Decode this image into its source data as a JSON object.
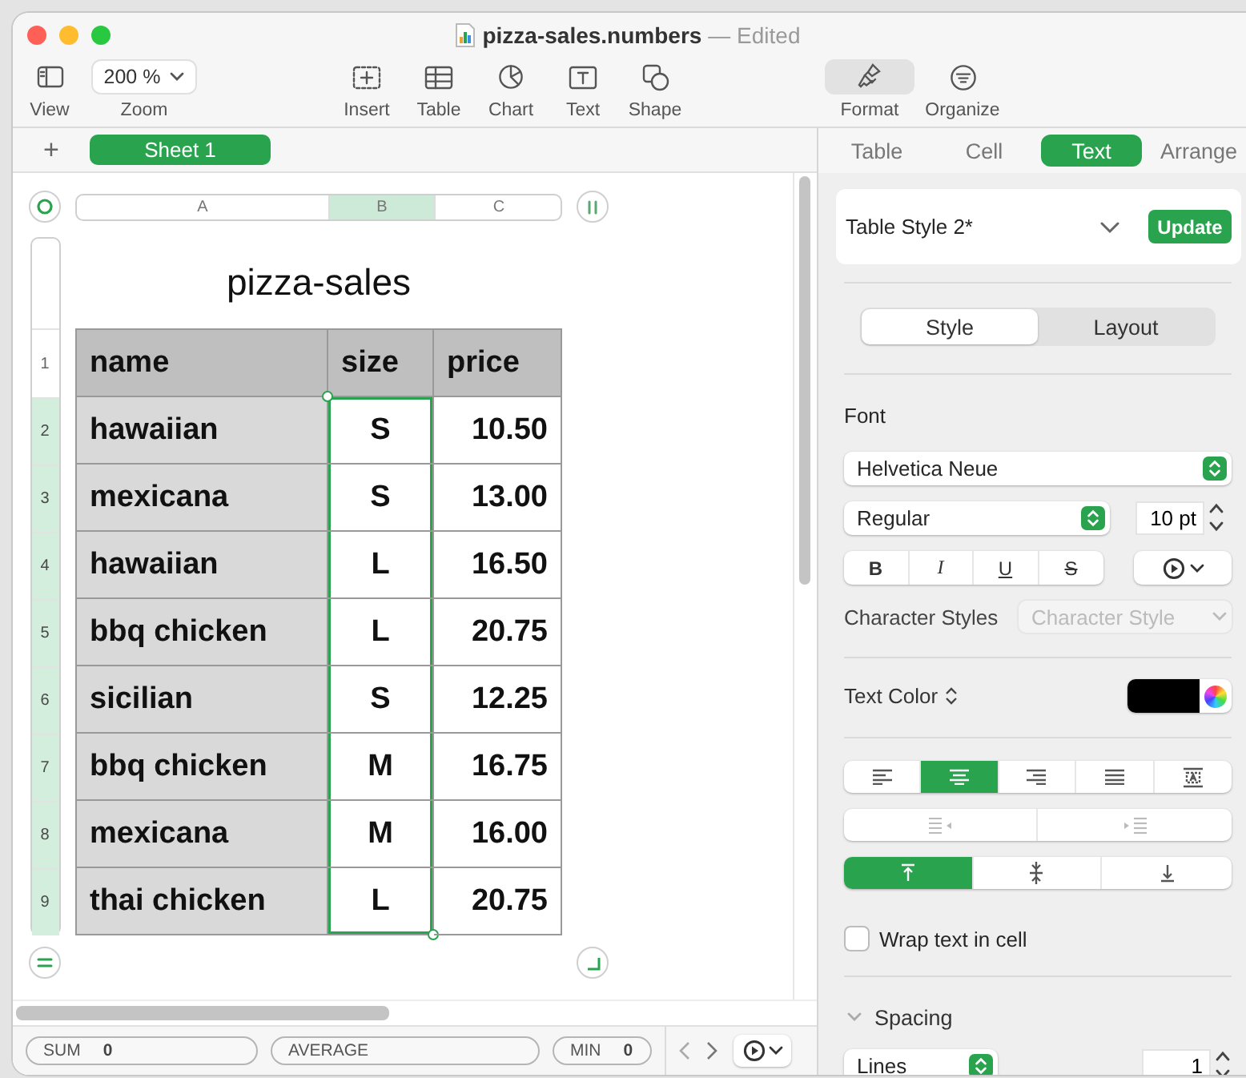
{
  "window": {
    "title": "pizza-sales.numbers",
    "status": "— Edited"
  },
  "toolbar": {
    "left": [
      {
        "kind": "view",
        "label": "View"
      },
      {
        "kind": "zoom",
        "label": "Zoom",
        "value": "200 %"
      }
    ],
    "insert": [
      {
        "kind": "insert",
        "label": "Insert"
      },
      {
        "kind": "table",
        "label": "Table"
      },
      {
        "kind": "chart",
        "label": "Chart"
      },
      {
        "kind": "text",
        "label": "Text"
      },
      {
        "kind": "shape",
        "label": "Shape"
      }
    ],
    "panels": [
      {
        "kind": "format",
        "label": "Format",
        "selected": true
      },
      {
        "kind": "organize",
        "label": "Organize",
        "selected": false
      }
    ]
  },
  "sheets": {
    "add": "+",
    "tabs": [
      {
        "label": "Sheet 1",
        "selected": true
      }
    ]
  },
  "table": {
    "title": "pizza-sales",
    "columns": [
      {
        "label": "A",
        "kind": "header",
        "selected": false
      },
      {
        "label": "B",
        "kind": "body",
        "selected": true
      },
      {
        "label": "C",
        "kind": "body",
        "selected": false
      }
    ],
    "rows": [
      {
        "number": "1",
        "kind": "header",
        "selected": false,
        "cells": [
          "name",
          "size",
          "price"
        ]
      },
      {
        "number": "2",
        "kind": "body",
        "selected": true,
        "cells": [
          "hawaiian",
          "S",
          "10.50"
        ]
      },
      {
        "number": "3",
        "kind": "body",
        "selected": true,
        "cells": [
          "mexicana",
          "S",
          "13.00"
        ]
      },
      {
        "number": "4",
        "kind": "body",
        "selected": true,
        "cells": [
          "hawaiian",
          "L",
          "16.50"
        ]
      },
      {
        "number": "5",
        "kind": "body",
        "selected": true,
        "cells": [
          "bbq chicken",
          "L",
          "20.75"
        ]
      },
      {
        "number": "6",
        "kind": "body",
        "selected": true,
        "cells": [
          "sicilian",
          "S",
          "12.25"
        ]
      },
      {
        "number": "7",
        "kind": "body",
        "selected": true,
        "cells": [
          "bbq chicken",
          "M",
          "16.75"
        ]
      },
      {
        "number": "8",
        "kind": "body",
        "selected": true,
        "cells": [
          "mexicana",
          "M",
          "16.00"
        ]
      },
      {
        "number": "9",
        "kind": "body",
        "selected": true,
        "cells": [
          "thai chicken",
          "L",
          "20.75"
        ]
      }
    ]
  },
  "status_bar": {
    "stats": [
      {
        "label": "SUM",
        "value": "0"
      },
      {
        "label": "AVERAGE"
      },
      {
        "label": "MIN",
        "value": "0"
      }
    ]
  },
  "inspector": {
    "tabs": [
      {
        "label": "Table",
        "selected": false
      },
      {
        "label": "Cell",
        "selected": false
      },
      {
        "label": "Text",
        "selected": true
      },
      {
        "label": "Arrange",
        "selected": false
      }
    ],
    "style": {
      "name": "Table Style 2*",
      "button": "Update"
    },
    "modes": [
      {
        "label": "Style",
        "selected": true
      },
      {
        "label": "Layout",
        "selected": false
      }
    ],
    "font": {
      "label": "Font",
      "family": "Helvetica Neue",
      "typeface": "Regular",
      "size": "10 pt"
    },
    "char_format": [
      {
        "kind": "bold",
        "label": "B"
      },
      {
        "kind": "italic",
        "label": "I"
      },
      {
        "kind": "underline",
        "label": "U"
      },
      {
        "kind": "strike",
        "label": "S"
      }
    ],
    "character_styles": {
      "label": "Character Styles",
      "placeholder": "Character Style",
      "disabled": true
    },
    "text_color": {
      "label": "Text Color",
      "color": "#000000"
    },
    "alignment": [
      {
        "kind": "left",
        "selected": false
      },
      {
        "kind": "center",
        "selected": true
      },
      {
        "kind": "right",
        "selected": false
      },
      {
        "kind": "justify",
        "selected": false
      },
      {
        "kind": "auto",
        "selected": false
      }
    ],
    "indent": [
      {
        "kind": "decrease",
        "disabled": true
      },
      {
        "kind": "increase",
        "disabled": true
      }
    ],
    "vertical_alignment": [
      {
        "kind": "top",
        "selected": true
      },
      {
        "kind": "middle",
        "selected": false
      },
      {
        "kind": "bottom",
        "selected": false
      }
    ],
    "wrap": {
      "label": "Wrap text in cell",
      "checked": false
    },
    "spacing": {
      "label": "Spacing",
      "expanded": true,
      "mode": "Lines",
      "value": "1"
    }
  }
}
